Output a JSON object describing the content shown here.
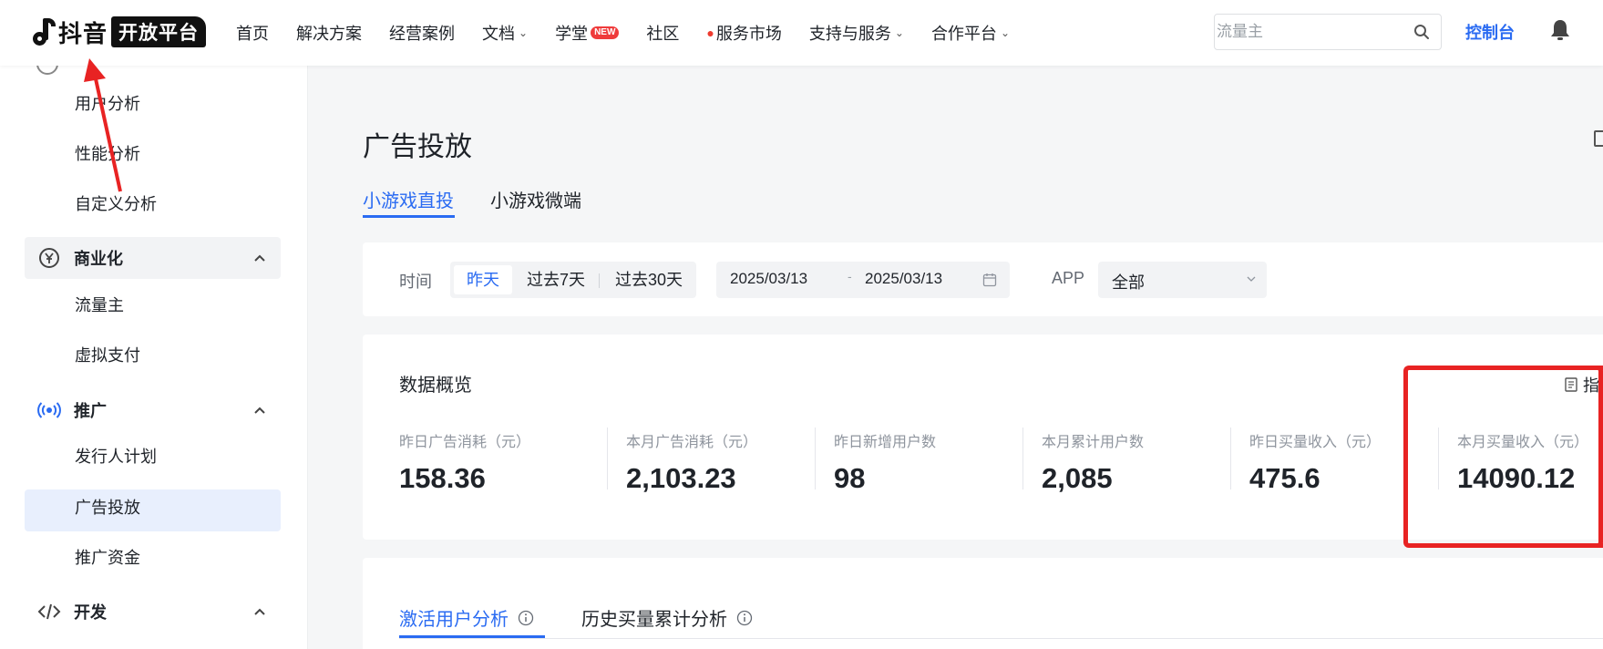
{
  "brand": {
    "name": "抖音",
    "badge": "开放平台"
  },
  "nav": {
    "items": [
      {
        "label": "首页"
      },
      {
        "label": "解决方案"
      },
      {
        "label": "经营案例"
      },
      {
        "label": "文档"
      },
      {
        "label": "学堂",
        "badge": "NEW"
      },
      {
        "label": "社区"
      },
      {
        "label": "服务市场"
      },
      {
        "label": "支持与服务"
      },
      {
        "label": "合作平台"
      }
    ],
    "search_placeholder": "流量主",
    "console_label": "控制台"
  },
  "sidebar": {
    "sub_items_top": [
      "用户分析",
      "性能分析",
      "自定义分析"
    ],
    "groups": [
      {
        "label": "商业化",
        "icon": "yen-icon",
        "items": [
          "流量主",
          "虚拟支付"
        ]
      },
      {
        "label": "推广",
        "icon": "broadcast-icon",
        "items": [
          "发行人计划",
          "广告投放",
          "推广资金"
        ]
      },
      {
        "label": "开发",
        "icon": "code-icon",
        "items": []
      }
    ],
    "active_item": "广告投放"
  },
  "main": {
    "title": "广告投放",
    "tabs": [
      {
        "label": "小游戏直投"
      },
      {
        "label": "小游戏微端"
      }
    ],
    "filter": {
      "time_label": "时间",
      "time_options": [
        "昨天",
        "过去7天",
        "过去30天"
      ],
      "date_start": "2025/03/13",
      "date_sep": "-",
      "date_end": "2025/03/13",
      "app_label": "APP",
      "app_value": "全部"
    },
    "overview": {
      "title": "数据概览",
      "right_text": "指",
      "metrics": [
        {
          "label": "昨日广告消耗（元）",
          "value": "158.36"
        },
        {
          "label": "本月广告消耗（元）",
          "value": "2,103.23"
        },
        {
          "label": "昨日新增用户数",
          "value": "98"
        },
        {
          "label": "本月累计用户数",
          "value": "2,085"
        },
        {
          "label": "昨日买量收入（元）",
          "value": "475.6"
        },
        {
          "label": "本月买量收入（元）",
          "value": "14090.12"
        }
      ]
    },
    "analysis_tabs": [
      {
        "label": "激活用户分析"
      },
      {
        "label": "历史买量累计分析"
      }
    ]
  },
  "colors": {
    "accent": "#2a6bf2",
    "highlight": "#e82323",
    "new_badge": "#ef3b3b"
  }
}
